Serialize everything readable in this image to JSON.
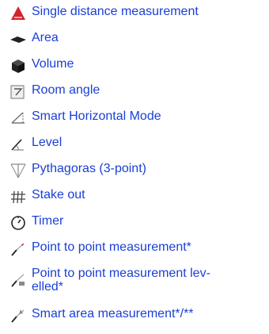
{
  "colors": {
    "link": "#1a3fd6",
    "icon_gray": "#6e6e6e",
    "icon_dark": "#222222",
    "icon_red": "#d2232a"
  },
  "items": [
    {
      "label": "Single distance measurement",
      "icon": "single-distance-icon"
    },
    {
      "label": "Area",
      "icon": "area-icon"
    },
    {
      "label": "Volume",
      "icon": "volume-icon"
    },
    {
      "label": "Room angle",
      "icon": "room-angle-icon"
    },
    {
      "label": "Smart Horizontal Mode",
      "icon": "smart-horizontal-icon"
    },
    {
      "label": "Level",
      "icon": "level-icon"
    },
    {
      "label": "Pythagoras (3-point)",
      "icon": "pythagoras-icon"
    },
    {
      "label": "Stake out",
      "icon": "stake-out-icon"
    },
    {
      "label": "Timer",
      "icon": "timer-icon"
    },
    {
      "label": "Point to point measurement*",
      "icon": "point-to-point-icon"
    },
    {
      "label_line1": "Point to point measurement lev-",
      "label_line2": "elled*",
      "icon": "point-to-point-levelled-icon"
    },
    {
      "label": "Smart area measurement*/**",
      "icon": "smart-area-icon"
    }
  ]
}
